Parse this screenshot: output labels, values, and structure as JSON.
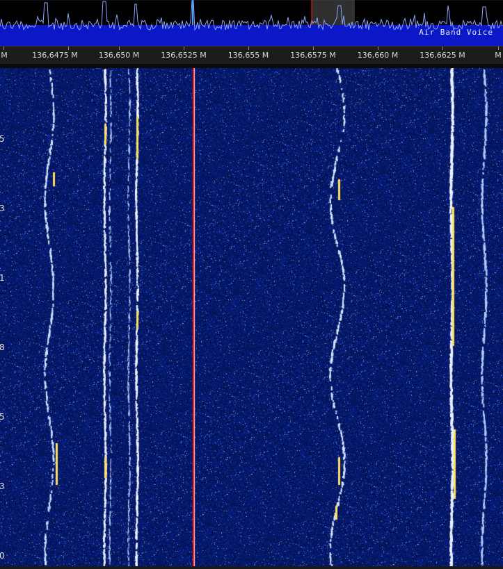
{
  "spectrum": {
    "band_label": "Air Band Voice",
    "colors": {
      "background": "#000000",
      "band_fill": "#0a18c8",
      "trace": "#8fa6ff",
      "marker": "#ff2020",
      "highlight": "#555555"
    }
  },
  "freq_axis": {
    "labels": [
      "M",
      "136,6475 M",
      "136,650 M",
      "136,6525 M",
      "136,655 M",
      "136,6575 M",
      "136,660 M",
      "136,6625 M",
      "M"
    ]
  },
  "waterfall": {
    "time_labels": [
      "5",
      "3",
      "1",
      "8",
      "5",
      "3",
      "0"
    ],
    "colors": {
      "background": "#06145e",
      "signal": "#ffe060",
      "marker": "#ff2020"
    }
  }
}
